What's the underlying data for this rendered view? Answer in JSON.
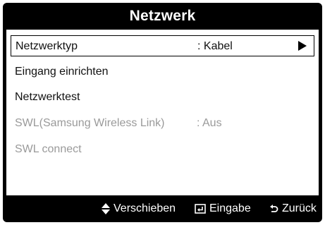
{
  "dialog": {
    "title": "Netzwerk"
  },
  "menu": {
    "items": [
      {
        "label": "Netzwerktyp",
        "value": ": Kabel",
        "state": "selected"
      },
      {
        "label": "Eingang einrichten",
        "value": "",
        "state": "enabled"
      },
      {
        "label": "Netzwerktest",
        "value": "",
        "state": "enabled"
      },
      {
        "label": "SWL(Samsung Wireless Link)",
        "value": ": Aus",
        "state": "disabled"
      },
      {
        "label": "SWL connect",
        "value": "",
        "state": "disabled"
      }
    ]
  },
  "footer": {
    "move_icon": "up-down-arrows-icon",
    "move_label": "Verschieben",
    "enter_icon": "enter-icon",
    "enter_label": "Eingabe",
    "back_icon": "return-icon",
    "back_label": "Zurück"
  },
  "colors": {
    "frame": "#000000",
    "content": "#ffffff",
    "text": "#111111",
    "disabled_text": "#9a9a9a"
  }
}
